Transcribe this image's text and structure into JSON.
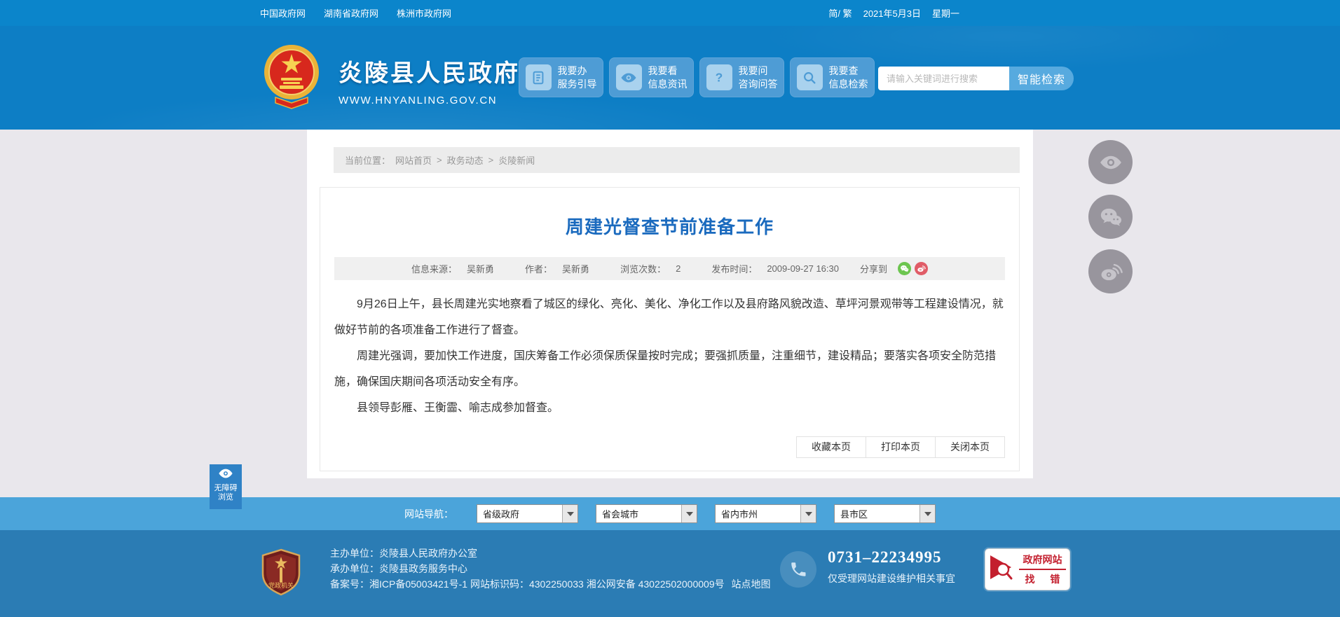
{
  "topbar": {
    "links": [
      "中国政府网",
      "湖南省政府网",
      "株洲市政府网"
    ],
    "lang_switch": "简/ 繁",
    "date": "2021年5月3日",
    "weekday": "星期一"
  },
  "header": {
    "site_name": "炎陵县人民政府",
    "site_url": "WWW.HNYANLING.GOV.CN",
    "services": [
      {
        "icon": "document-icon",
        "line1": "我要办",
        "line2": "服务引导"
      },
      {
        "icon": "eye-icon",
        "line1": "我要看",
        "line2": "信息资讯"
      },
      {
        "icon": "question-icon",
        "line1": "我要问",
        "line2": "咨询问答"
      },
      {
        "icon": "search-icon",
        "line1": "我要查",
        "line2": "信息检索"
      }
    ],
    "search": {
      "placeholder": "请输入关键词进行搜索",
      "button": "智能检索"
    }
  },
  "breadcrumb": {
    "label": "当前位置：",
    "separator": ">",
    "items": [
      "网站首页",
      "政务动态",
      "炎陵新闻"
    ]
  },
  "article": {
    "title": "周建光督查节前准备工作",
    "meta": {
      "source_label": "信息来源：",
      "source": "吴新勇",
      "author_label": "作者：",
      "author": "吴新勇",
      "views_label": "浏览次数：",
      "views": "2",
      "publish_label": "发布时间：",
      "publish_time": "2009-09-27 16:30",
      "share_label": "分享到",
      "share_icons": [
        "wechat-icon",
        "weibo-icon"
      ]
    },
    "paragraphs": [
      "9月26日上午，县长周建光实地察看了城区的绿化、亮化、美化、净化工作以及县府路风貌改造、草坪河景观带等工程建设情况，就做好节前的各项准备工作进行了督查。",
      "周建光强调，要加快工作进度，国庆筹备工作必须保质保量按时完成；要强抓质量，注重细节，建设精品；要落实各项安全防范措施，确保国庆期间各项活动安全有序。",
      "县领导彭雁、王衡霝、喻志成参加督查。"
    ],
    "actions": [
      "收藏本页",
      "打印本页",
      "关闭本页"
    ]
  },
  "footnav": {
    "label": "网站导航：",
    "selects": [
      "省级政府",
      "省会城市",
      "省内市州",
      "县市区"
    ]
  },
  "footer": {
    "emblem_text": "党政机关",
    "host_line": "主办单位：炎陵县人民政府办公室",
    "organizer_line": "承办单位：炎陵县政务服务中心",
    "icp_line": "备案号：湘ICP备05003421号-1 网站标识码：4302250033 湘公网安备 43022502000009号",
    "sitemap": "站点地图",
    "phone": "0731–22234995",
    "phone_note": "仅受理网站建设维护相关事宜",
    "badge_line1": "政府网站",
    "badge_line2": "找 错"
  },
  "floating": {
    "tools": [
      "eye-icon",
      "wechat-icon",
      "weibo-icon"
    ],
    "accessibility_line1": "无障碍",
    "accessibility_line2": "浏览"
  },
  "colors": {
    "topbar_blue": "#0b85cb",
    "header_blue": "#0d7ec5",
    "footnav_blue": "#4ba4da",
    "footer_blue": "#2b7cb4",
    "title_blue": "#1a6abe",
    "badge_red": "#c31f2e",
    "wechat_green": "#6cc54f",
    "weibo_red": "#e05c67"
  }
}
